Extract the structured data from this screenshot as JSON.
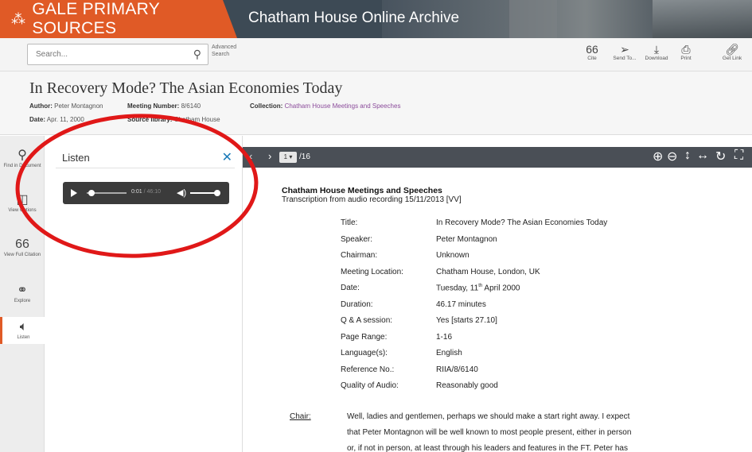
{
  "banner": {
    "brand": "GALE PRIMARY SOURCES",
    "archive": "Chatham House Online Archive"
  },
  "toolbar": {
    "search_placeholder": "Search...",
    "advanced_search": "Advanced Search",
    "tools": [
      {
        "label": "Cite",
        "icon": "quote-icon"
      },
      {
        "label": "Send To...",
        "icon": "send-icon"
      },
      {
        "label": "Download",
        "icon": "download-icon"
      },
      {
        "label": "Print",
        "icon": "print-icon"
      },
      {
        "label": "Get Link",
        "icon": "link-icon"
      }
    ]
  },
  "doc": {
    "title": "In Recovery Mode? The Asian Economies Today",
    "author_label": "Author:",
    "author": "Peter Montagnon",
    "meeting_label": "Meeting Number:",
    "meeting": "8/6140",
    "collection_label": "Collection:",
    "collection": "Chatham House Meetings and Speeches",
    "date_label": "Date:",
    "date": "Apr. 11, 2000",
    "source_label": "Source library:",
    "source": "Chatham House"
  },
  "rail": [
    {
      "label": "Find in Document",
      "icon": "search-icon"
    },
    {
      "label": "View Options",
      "icon": "book-icon"
    },
    {
      "label": "View Full Citation",
      "icon": "quote-icon"
    },
    {
      "label": "Explore",
      "icon": "binoculars-icon"
    },
    {
      "label": "Listen",
      "icon": "speaker-icon"
    }
  ],
  "listen": {
    "title": "Listen",
    "current_time": "0:01",
    "total_time": "/ 46:10",
    "progress": 0.0004
  },
  "viewer": {
    "page": "1",
    "total": "/16"
  },
  "page": {
    "heading": "Chatham House Meetings and Speeches",
    "subheading": "Transcription from audio recording 15/11/2013 [VV]",
    "fields": [
      {
        "k": "Title:",
        "v": "In Recovery Mode?  The Asian Economies Today"
      },
      {
        "k": "Speaker:",
        "v": "Peter Montagnon"
      },
      {
        "k": "Chairman:",
        "v": "Unknown"
      },
      {
        "k": "Meeting Location:",
        "v": "Chatham House, London, UK"
      },
      {
        "k": "Date:",
        "v": "Tuesday, 11th April 2000"
      },
      {
        "k": "Duration:",
        "v": "46.17 minutes"
      },
      {
        "k": "Q & A session:",
        "v": "Yes [starts 27.10]"
      },
      {
        "k": "Page Range:",
        "v": "1-16"
      },
      {
        "k": "Language(s):",
        "v": "English"
      },
      {
        "k": "Reference No.:",
        "v": "RIIA/8/6140"
      },
      {
        "k": "Quality of Audio:",
        "v": "Reasonably good"
      }
    ],
    "chair_label": "Chair:",
    "body": [
      "Well, ladies and gentlemen, perhaps we should make a start right away.  I expect",
      "that Peter Montagnon will be well known to most people present, either in person",
      "or, if not in person, at least through his leaders and features in the FT.  Peter has"
    ]
  },
  "colors": {
    "brand": "#e05a26",
    "annotation": "#e01818"
  }
}
